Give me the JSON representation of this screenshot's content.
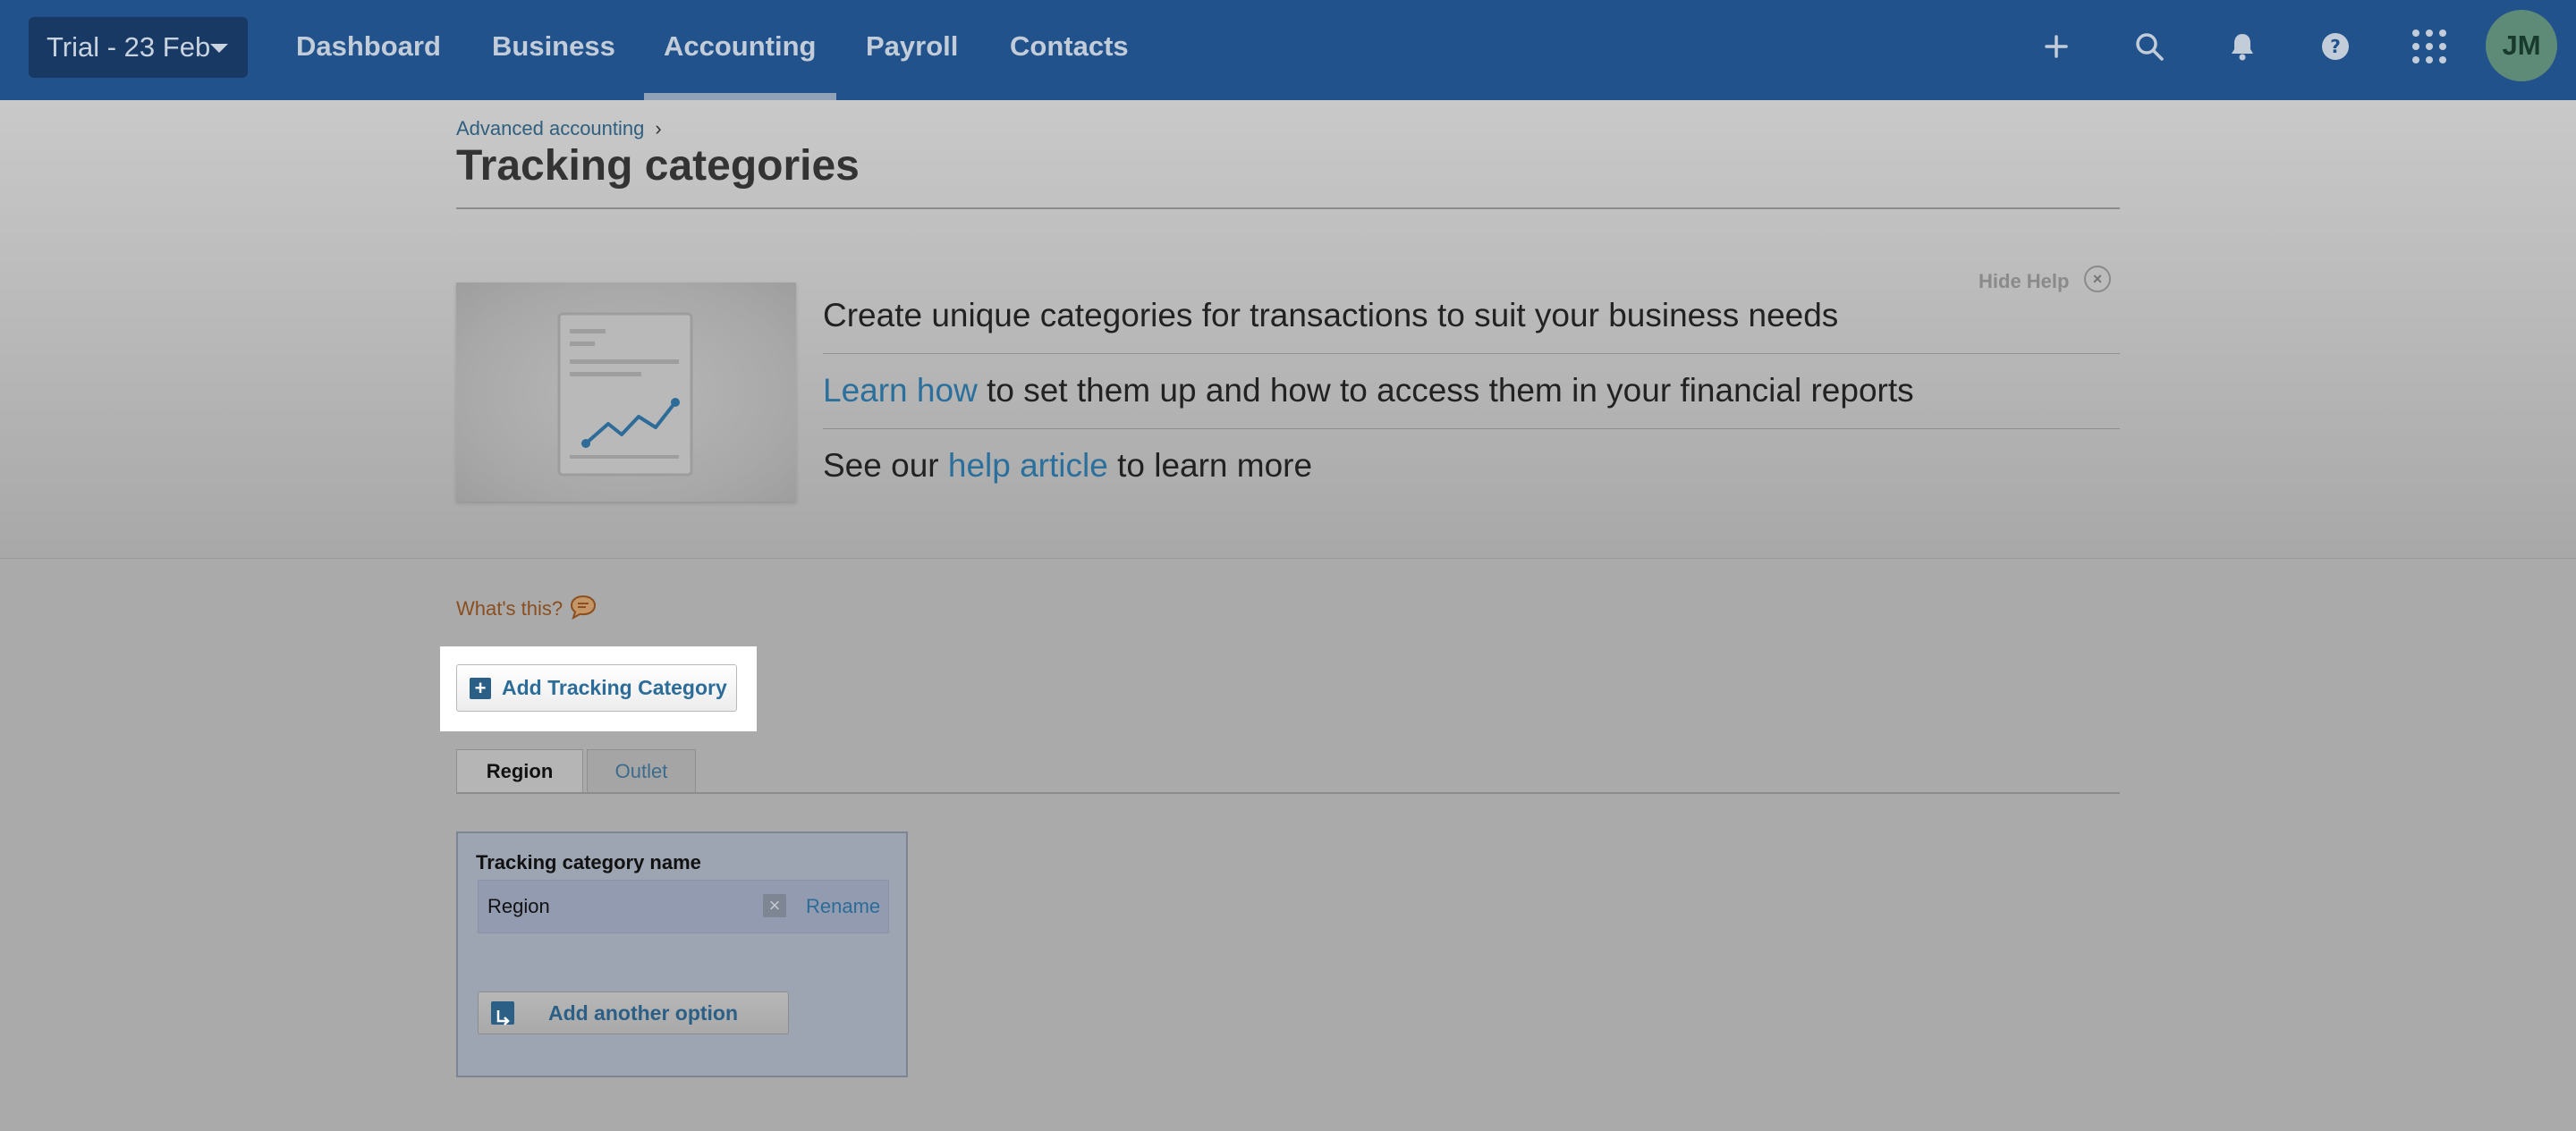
{
  "topbar": {
    "org": "Trial - 23 Feb",
    "nav": [
      "Dashboard",
      "Business",
      "Accounting",
      "Payroll",
      "Contacts"
    ],
    "active_nav": "Accounting",
    "icons": [
      "plus-icon",
      "search-icon",
      "bell-icon",
      "help-icon",
      "apps-grid-icon"
    ],
    "avatar": "JM"
  },
  "breadcrumb": {
    "parent": "Advanced accounting",
    "sep": "›"
  },
  "page": {
    "title": "Tracking categories"
  },
  "help": {
    "hide_label": "Hide Help",
    "close_glyph": "×",
    "line1": "Create unique categories for transactions to suit your business needs",
    "line2_link": "Learn how",
    "line2_rest": " to set them up and how to access them in your financial reports",
    "line3_pre": "See our ",
    "line3_link": "help article",
    "line3_post": " to learn more"
  },
  "main": {
    "whats_this": "What's this?",
    "add_button": "Add Tracking Category",
    "tabs": [
      "Region",
      "Outlet"
    ],
    "active_tab": "Region",
    "panel": {
      "name_label": "Tracking category name",
      "name_value": "Region",
      "rename": "Rename",
      "add_option": "Add another option"
    }
  },
  "colors": {
    "topbar": "#22528b",
    "link": "#2b6f9c",
    "overlay": "#aaaaaa"
  }
}
